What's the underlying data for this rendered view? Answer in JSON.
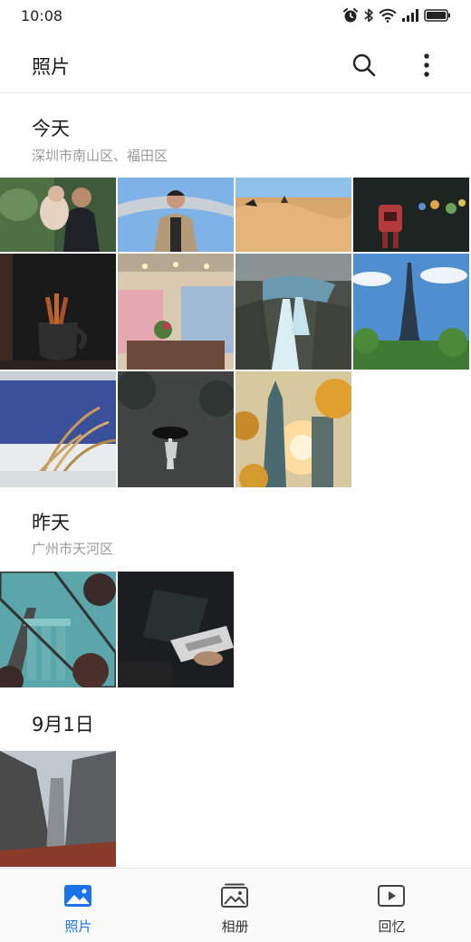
{
  "status": {
    "time": "10:08"
  },
  "appbar": {
    "title": "照片"
  },
  "sections": [
    {
      "title": "今天",
      "location": "深圳市南山区、福田区"
    },
    {
      "title": "昨天",
      "location": "广州市天河区"
    },
    {
      "title": "9月1日",
      "location": ""
    }
  ],
  "nav": {
    "photos": "照片",
    "albums": "相册",
    "memories": "回忆"
  },
  "colors": {
    "accent": "#1a73e8"
  }
}
